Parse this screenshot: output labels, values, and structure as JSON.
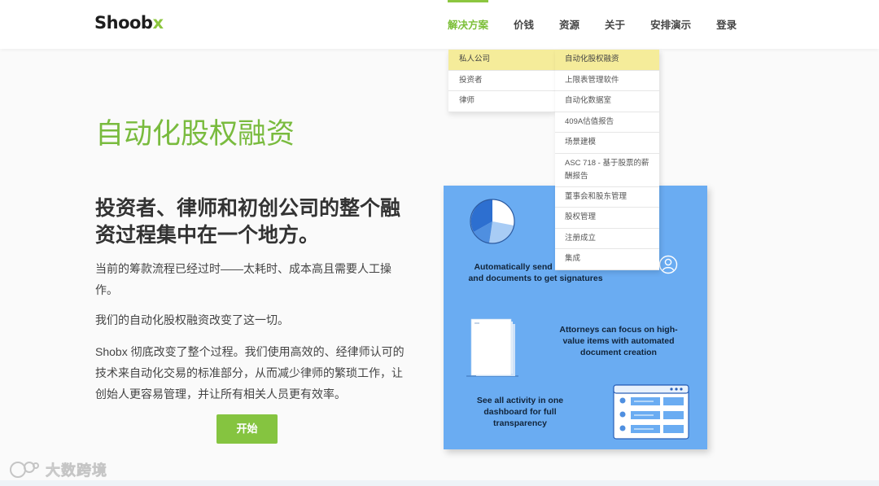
{
  "header": {
    "logo_text": "Shoob",
    "logo_accent": "x",
    "nav": [
      {
        "label": "解决方案",
        "active": true
      },
      {
        "label": "价钱"
      },
      {
        "label": "资源"
      },
      {
        "label": "关于"
      },
      {
        "label": "安排演示"
      },
      {
        "label": "登录"
      }
    ]
  },
  "dropdown": {
    "col1": [
      "私人公司",
      "投资者",
      "律师"
    ],
    "col2": [
      "自动化股权融资",
      "上限表管理软件",
      "自动化数据室",
      "409A估值报告",
      "场景建模",
      "ASC 718 - 基于股票的薪酬报告",
      "董事会和股东管理",
      "股权管理",
      "注册成立",
      "集成"
    ]
  },
  "hero": {
    "title": "自动化股权融资",
    "subheading": "投资者、律师和初创公司的整个融资过程集中在一个地方。",
    "p1": "当前的筹款流程已经过时——太耗时、成本高且需要人工操作。",
    "p2": "我们的自动化股权融资改变了这一切。",
    "p3": "Shobx 彻底改变了整个过程。我们使用高效的、经律师认可的技术来自动化交易的标准部分，从而减少律师的繁琐工作，让创始人更容易管理，并让所有相关人员更有效率。",
    "cta": "开始"
  },
  "illustration": {
    "t1": "Automatically send out emails and documents to get signatures",
    "t2": "Attorneys can focus on high-value items  with automated document creation",
    "t3": "See all activity in one dashboard for full transparency"
  },
  "watermark": {
    "text": "大数跨境"
  },
  "colors": {
    "brand_green": "#8cc63f",
    "illustration_bg": "#6aacf2",
    "menu_highlight": "#f5ec9a"
  }
}
